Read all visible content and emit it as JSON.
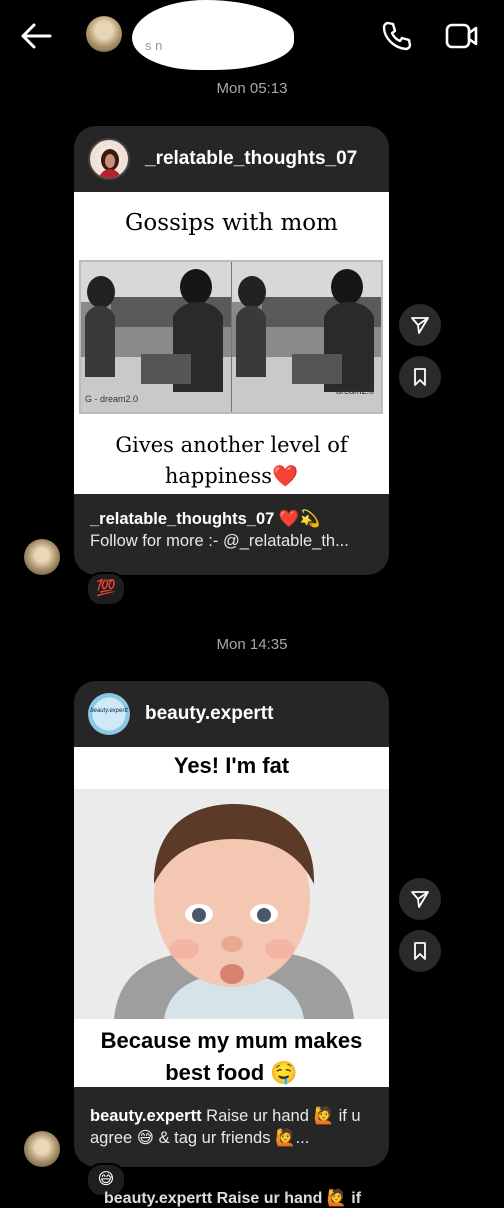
{
  "header": {
    "subtitle": "s                n",
    "icons": [
      "back-arrow-icon",
      "phone-icon",
      "video-camera-icon"
    ]
  },
  "messages": [
    {
      "timestamp": "Mon 05:13",
      "card": {
        "username": "_relatable_thoughts_07",
        "post_title": "Gossips with mom",
        "post_bottom_line1": "Gives another level of",
        "post_bottom_line2": "happiness",
        "post_bottom_emoji": "❤️",
        "watermark_left": "G - dream2.0",
        "watermark_right": "dream2.0",
        "caption_user": "_relatable_thoughts_07",
        "caption_emoji": "❤️💫",
        "caption_text": "Follow for more :- @_relatable_th..."
      },
      "reaction": "💯"
    },
    {
      "timestamp": "Mon 14:35",
      "card": {
        "username": "beauty.expertt",
        "avatar_text": "beauty.expertt",
        "post_top": "Yes! I'm fat",
        "post_bottom_line1": "Because my mum makes",
        "post_bottom_line2": "best food",
        "post_bottom_emoji": "🤤",
        "caption_user": "beauty.expertt",
        "caption_text": "Raise ur hand 🙋 if u agree 😅 & tag ur friends 🙋..."
      },
      "reaction": "😅"
    }
  ],
  "partial_text": "beauty.expertt Raise ur hand 🙋 if",
  "colors": {
    "background": "#000000",
    "card": "#262626",
    "timestamp": "#a8a8a8",
    "heart": "#d6242b"
  }
}
